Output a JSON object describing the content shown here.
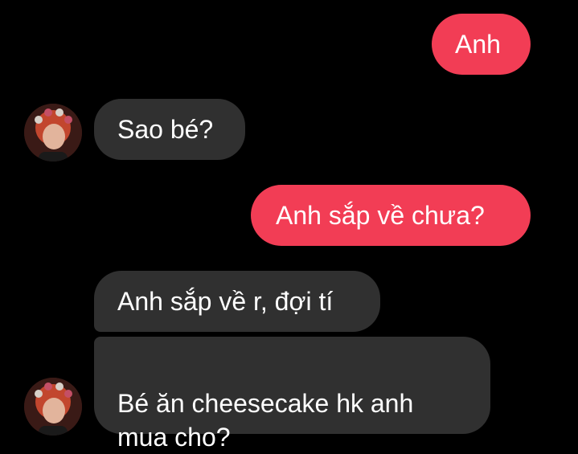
{
  "conversation": {
    "messages": [
      {
        "side": "sent",
        "text": "Anh"
      },
      {
        "side": "received",
        "text": "Sao bé?"
      },
      {
        "side": "sent",
        "text": "Anh sắp về chưa?"
      },
      {
        "side": "received",
        "text": "Anh sắp về r, đợi tí"
      },
      {
        "side": "received",
        "text": "Bé ăn cheesecake hk anh\nmua cho?"
      }
    ],
    "contact_avatar": "profile-photo",
    "colors": {
      "background": "#000000",
      "sent_bubble": "#f23d55",
      "received_bubble": "#303030",
      "text": "#ffffff"
    }
  }
}
